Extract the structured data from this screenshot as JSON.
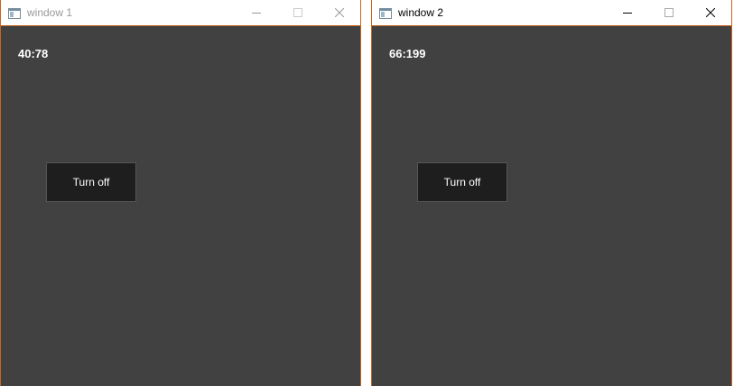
{
  "windows": [
    {
      "title": "window 1",
      "active": false,
      "counter": "40:78",
      "button_label": "Turn off"
    },
    {
      "title": "window 2",
      "active": true,
      "counter": "66:199",
      "button_label": "Turn off"
    }
  ],
  "icons": {
    "app": "app-window-icon",
    "minimize": "minimize-icon",
    "maximize": "maximize-icon",
    "close": "close-icon"
  },
  "colors": {
    "client_bg": "#414141",
    "button_bg": "#1e1e1e",
    "window_border": "#c8641e",
    "titlebar_bg": "#ffffff"
  }
}
